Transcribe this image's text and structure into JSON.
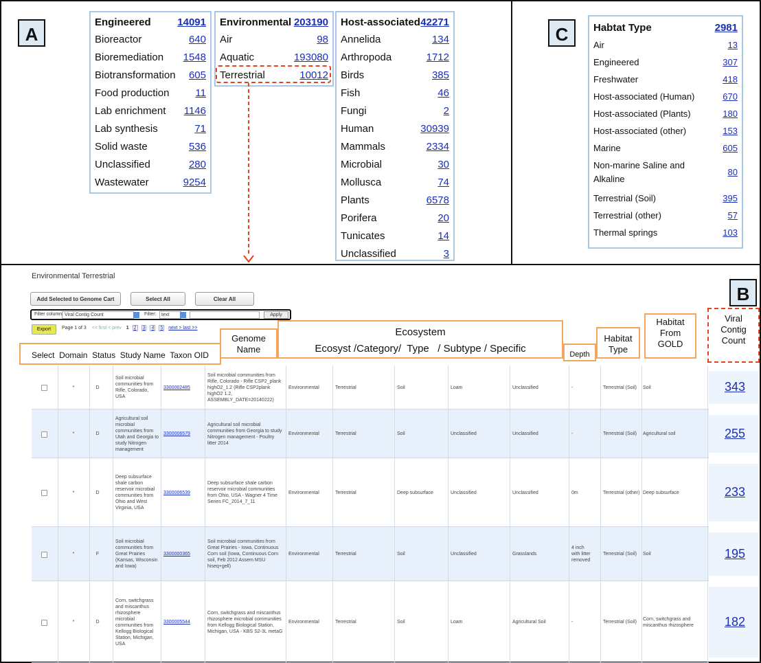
{
  "panels": {
    "a": "A",
    "b": "B",
    "c": "C"
  },
  "engineered": {
    "header": {
      "label": "Engineered",
      "count": "14091"
    },
    "rows": [
      {
        "label": "Bioreactor",
        "count": "640"
      },
      {
        "label": "Bioremediation",
        "count": "1548"
      },
      {
        "label": "Biotransformation",
        "count": "605"
      },
      {
        "label": "Food production",
        "count": "11"
      },
      {
        "label": "Lab enrichment",
        "count": "1146"
      },
      {
        "label": "Lab synthesis",
        "count": "71"
      },
      {
        "label": "Solid waste",
        "count": "536"
      },
      {
        "label": "Unclassified",
        "count": "280"
      },
      {
        "label": "Wastewater",
        "count": "9254"
      }
    ]
  },
  "environmental": {
    "header": {
      "label": "Environmental",
      "count": "203190"
    },
    "rows": [
      {
        "label": "Air",
        "count": "98"
      },
      {
        "label": "Aquatic",
        "count": "193080"
      },
      {
        "label": "Terrestrial",
        "count": "10012"
      }
    ]
  },
  "host": {
    "header": {
      "label": "Host-associated",
      "count": "42271"
    },
    "rows": [
      {
        "label": "Annelida",
        "count": "134"
      },
      {
        "label": "Arthropoda",
        "count": "1712"
      },
      {
        "label": "Birds",
        "count": "385"
      },
      {
        "label": "Fish",
        "count": "46"
      },
      {
        "label": "Fungi",
        "count": "2"
      },
      {
        "label": "Human",
        "count": "30939"
      },
      {
        "label": "Mammals",
        "count": "2334"
      },
      {
        "label": "Microbial",
        "count": "30"
      },
      {
        "label": "Mollusca",
        "count": "74"
      },
      {
        "label": "Plants",
        "count": "6578"
      },
      {
        "label": "Porifera",
        "count": "20"
      },
      {
        "label": "Tunicates",
        "count": "14"
      },
      {
        "label": "Unclassified",
        "count": "3"
      }
    ]
  },
  "habitat": {
    "header": {
      "label": "Habtat Type",
      "count": "2981"
    },
    "rows": [
      {
        "label": "Air",
        "count": "13"
      },
      {
        "label": "Engineered",
        "count": "307"
      },
      {
        "label": "Freshwater",
        "count": "418"
      },
      {
        "label": "Host-associated (Human)",
        "count": "670"
      },
      {
        "label": "Host-associated (Plants)",
        "count": "180"
      },
      {
        "label": "Host-associated (other)",
        "count": "153"
      },
      {
        "label": "Marine",
        "count": "605"
      },
      {
        "label": "Non-marine Saline and",
        "label2": "Alkaline",
        "count": "80"
      },
      {
        "label": "Terrestrial (Soil)",
        "count": "395"
      },
      {
        "label": "Terrestrial (other)",
        "count": "57"
      },
      {
        "label": "Thermal springs",
        "count": "103"
      }
    ]
  },
  "table_view": {
    "title": "Environmental Terrestrial",
    "add_cart": "Add Selected to Genome Cart",
    "select_all": "Select All",
    "clear_all": "Clear All",
    "filter_label": "Filter column:",
    "filter_column": "Viral Contig Count",
    "filter_word": "Filter:",
    "filter_type": "text",
    "apply": "Apply",
    "export": "Export",
    "pager": {
      "page_info": "Page 1 of 3",
      "nav_prev": "<< first  < prev",
      "pages": [
        "1",
        "2",
        "3",
        "4",
        "5"
      ],
      "nav_next": "next >  last >>"
    }
  },
  "headers": {
    "genome_name": "Genome Name",
    "ecosystem": "Ecosystem",
    "eco_sub": "Ecosyst /Category/  Type   / Subtype / Specific",
    "left_cols": "Select  Domain  Status  Study Name  Taxon OID",
    "depth": "Depth",
    "habitat_type": "Habitat Type",
    "habitat_gold": "Habitat From GOLD",
    "viral_count": "Viral Contig Count"
  },
  "rows": [
    {
      "domain": "*",
      "status": "D",
      "study": "Soil microbial communities from Rifle, Colorado, USA",
      "taxon": "3300002485",
      "genome": "Soil microbial communities from Rifle, Colorado - Rifle CSP2_plank highO2_1.2 (Rifle CSP2plank highO2 1.2, ASSEMBLY_DATE=20140222)",
      "ecosyst": "Environmental",
      "category": "Terrestrial",
      "type": "Soil",
      "subtype": "Loam",
      "specific": "Unclassified",
      "depth": "-",
      "habitat": "Terrestrial (Soil)",
      "gold": "Soil",
      "viral": "343"
    },
    {
      "domain": "*",
      "status": "D",
      "study": "Agricultural soil microbial communities from Utah and Georgia to study Nitrogen management",
      "taxon": "3300006579",
      "genome": "Agricultural soil microbial communities from Georgia to study Nitrogen management - Poultry litter 2014",
      "ecosyst": "Environmental",
      "category": "Terrestrial",
      "type": "Soil",
      "subtype": "Unclassified",
      "specific": "Unclassified",
      "depth": "-",
      "habitat": "Terrestrial (Soil)",
      "gold": "Agricultural soil",
      "viral": "255"
    },
    {
      "domain": "*",
      "status": "D",
      "study": "Deep subsurface shale carbon reservoir microbial communities from Ohio and West Virginia, USA",
      "taxon": "3300006539",
      "genome": "Deep subsurface shale carbon reservoir microbial communities from Ohio, USA - Wagner 4 Time Series FC_2014_7_11",
      "ecosyst": "Environmental",
      "category": "Terrestrial",
      "type": "Deep subsurface",
      "subtype": "Unclassified",
      "specific": "Unclassified",
      "depth": "0m",
      "habitat": "Terrestrial (other)",
      "gold": "Deep subsurface",
      "viral": "233"
    },
    {
      "domain": "*",
      "status": "F",
      "study": "Soil microbial communities from Great Prairies (Kansas, Wisconsin and Iowa)",
      "taxon": "3300000365",
      "genome": "Soil microbial communities from Great Prairies - Iowa, Continuous Corn soil (Iowa, Continuous Corn soil, Feb 2012 Assem MSU hiseq+gell)",
      "ecosyst": "Environmental",
      "category": "Terrestrial",
      "type": "Soil",
      "subtype": "Unclassified",
      "specific": "Grasslands",
      "depth": "4 inch with litter removed",
      "habitat": "Terrestrial (Soil)",
      "gold": "Soil",
      "viral": "195"
    },
    {
      "domain": "*",
      "status": "D",
      "study": "Corn, switchgrass and miscanthus rhizosphere microbial communities from Kellogg Biological Station, Michigan, USA",
      "taxon": "3300005544",
      "genome": "Corn, switchgrass and miscanthus rhizosphere microbial communities from Kellogg Biological Station, Michigan, USA - KBS S2-3L metaG",
      "ecosyst": "Environmental",
      "category": "Terrestrial",
      "type": "Soil",
      "subtype": "Loam",
      "specific": "Agricultural Soil",
      "depth": "-",
      "habitat": "Terrestrial (Soil)",
      "gold": "Corn, switchgrass and miscanthus rhizosphere",
      "viral": "182"
    }
  ]
}
